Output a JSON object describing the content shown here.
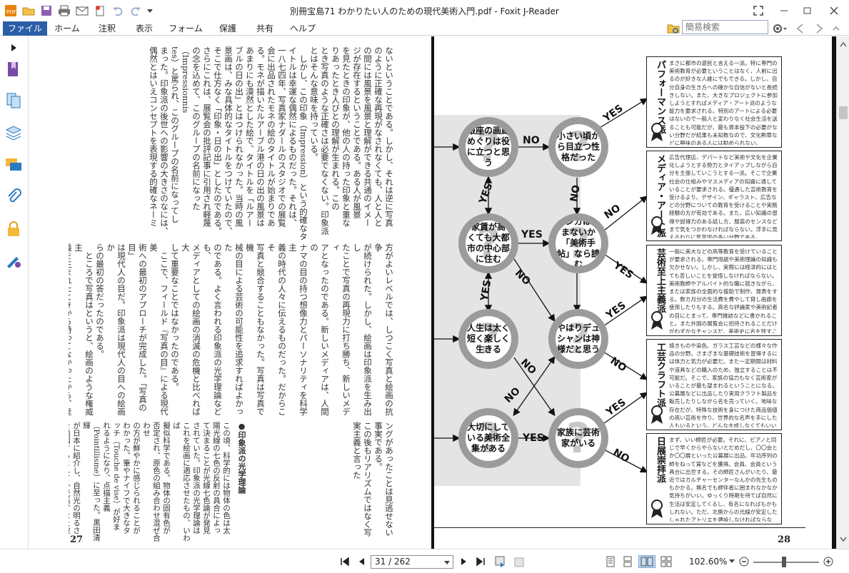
{
  "window": {
    "title": "別冊宝島71 わかりたい人のための現代美術入門.pdf - Foxit J-Reader"
  },
  "menu_tabs": [
    "ファイル",
    "ホーム",
    "注釈",
    "表示",
    "フォーム",
    "保護",
    "共有",
    "ヘルプ"
  ],
  "search": {
    "placeholder": "簡易検索"
  },
  "status": {
    "page_display": "31 / 262",
    "zoom": "102.60%"
  },
  "left_page": {
    "number": "27",
    "top_columns": [
      "ないということである。しかし、それは逆に写真",
      "のように正確な再現がなされなくても、人と人と",
      "の間には風景を風景と理解ができる共通のイメー",
      "ジが存在するということである。ある人が風景",
      "を見たときの印象が、他の人の持った印象と重な",
      "りあったとき人びとの理解が生まれる。この",
      "とき写真のような正確さは必要でなくない。印象派",
      "とはそんな意味を持っている。",
      "　しかし、この印象（Impression）という的確なタ",
      "イトルは幸運な偶然によるものだった。それは、",
      "一八七四年、写真家ナダールのスタジオでの展覧",
      "会に出品されたモネの絵のタイトルが始まりであ",
      "る。モネが描いたルアーブル港の日の出の風景は",
      "あまりにも漠然とした絵で、タイトルを「ルアー",
      "ブルの日の出」とはつけられなかった。当時の風",
      "景画は、みな具体的なタイトルをつけていたので、",
      "そこで仕方なく「印象・日の出」としたのである。",
      "さらにこれは、展覧会の批評記事に引用され軽蔑",
      "の念を込めて、このグループの名前になった（Impressionnis",
      "tes）と罵られ、このグループの名前になってし",
      "まった。印象派の後世への影響の大きさのなには、",
      "偶然とはいえコンセプトを表現する的確なネーミ",
      "ングがあったことは見逃せない事実である。",
      "この後もリアリズムではなく写実主義と言った"
    ],
    "right_columns_top": [
      "方がよいレベルでは、しつこく写真と絵画の抗争",
      "が続けられた。しかし、絵画は印象派を生み出し",
      "たことで写真の再現力に打ち勝ち、新しいメディ",
      "アとなったのである。新しいメディアは、人間の",
      "ナマの目の持つ想像力とパーソナリティを科学主",
      "義の時代の人々に伝えるものだった。だからこそ",
      "写真と競合することもなかった。写真は写真で機",
      "械の目による芸術の可能性を追求すればよかった",
      "のである。よく言われる印象派の光学理論なども、",
      "メディアとしての絵画の消滅の危機と比べれば大",
      "して重要なことではなかったのである。",
      "　ここで、フィールド『写真の目』による現代美",
      "術への最初のアプローチが完成した。「写真の目」",
      "は現代人の目だ。印象派は現代人の目への絵画か",
      "らの最初の答だったのである。",
      "　ところで写真はというと、絵画のような権威主",
      "義を生まれたときから持ってなかったから、産業",
      "の発達に押されるままに新たな方向に進出して",
      "行った。ゴッホやゴーギャンが登場する後期印象",
      "派（P32）と呼ばれる時代には、映画とアマチュア",
      "写真、グラビア印刷という新たなヴィジュアルも",
      "生み出される。これはたちまち絵画へのフィードバ",
      "ックされ、再び過激な時代に突入していくのであ",
      "る。"
    ],
    "note_title": "●印象派の光学理論",
    "note_columns": [
      "この頃、科学的には物体の色は太",
      "陽光線の七色の反射の具合によっ",
      "て決まることが光線七色論が発見",
      "されていた。印象派の光学理論は",
      "これを絵画に適応させたもの、いわば",
      "擬似科学である。物体の固有色が",
      "否定され、原色の組み合わせ混ぜ合わせ",
      "の方が鮮やかに感じられることが",
      "わかった。筆やナイフで大きなタ",
      "ッチ（Touche de vise）が好ま",
      "れるようになり、点描主義",
      "（Pointillisme）に至った。黒田清輝",
      "が日本に紹介し、自然光の明るさ",
      "を強調するとして外光派、また彼",
      "らが陰影に黒を使わなかったことか",
      "ら、むらさき派とも呼ばれた。"
    ]
  },
  "right_page": {
    "number": "28",
    "nodes": [
      "銀座の画廊めぐりは役に立つと思う",
      "小さい頃から目立つ性格だった",
      "家賃が高くても大都市の中心部に住む",
      "マンガは読まないか「美術手帖」なら読む",
      "人生は太く短く楽しく生きる",
      "やはりデュシャンは神様だと思う",
      "大切にしている美術全集がある",
      "家族に芸術家がいる"
    ],
    "labels": {
      "yes": "YES",
      "no": "NO"
    },
    "results": [
      {
        "title": "パフォーマンス派",
        "body": "まさに都市の遊民と言える一派。特に専門の美術教育が必要ということはなく、人前に出るのが好きな人誰にでもできる。しかし、自分自身の生き方への確かな自信がないと長続きしない。また、大きなプロジェクトに参加しようとすればメディア・アート派のような能力を要求される。特別のアートによる必要はないので一般人と変わりなく社会生活を送ることも可能だが、最も資本投下の必要がない分野だが結果も未知数なので、文化勲章などに興味のある人には勧められない。"
      },
      {
        "title": "メディア・アート派",
        "body": "広告代理店、デパートなど美術や文化を企業化しようとする勢力とタイアップしながら自分を主張していこうとする一派。そこで企業社会の仕組みやマスメディアの知識に通していることが要求される。優遇した芸術教育を受けるより、デザイン、ギャラスト、広告などの分野についての教育を受けることや実務経験の方が有効である。また、広い知識の習得や説得力のある話し方、服装のセンスなどまで気をつかわなければならない。浮手に見えるわりに気苦労の多い分野である。"
      },
      {
        "title": "芸術至上主義派",
        "body": "一般に美大などの高等教育を受けていることが要求される。専門用語や美術理論の知識も欠かせない。しかし、実際には経済的にはとても苦しいことを覚悟しなければならない。美術教師やアルバイト的な職に就きながら、または家族の全面的な援助で制作、発表をする。数カ月分の生活費を費やして貸し画廊を使用したりもする。高名な評論家や美術記者の目にとまって、専門雑誌などに書かれること。また外国の展覧会に招待されることだけがわずかなチャンスだ。美術史に名を残すことが最大の名誉なのである。"
      },
      {
        "title": "工芸クラフト派",
        "body": "焼きものや染色、ガラス工芸などの様々な作品の分野。さまざまな基礎技術を習得するには体力と気力が必要だ。また一定期間は材料や道具などの購入のため、独立することは不可能だ。そこで、家族の協力もなく芸術家がいることが最も望まれるということになる。公募展などに出品したり実用クラフト製品を販売したりしながら名を売っていく。地味な存在だが、特殊な技術を身につけた商品価値の高い芸術を作り、世界的な名声を手にした人もいるという。どんな大成しなくてもいいのだ。もちろん、親の七光りという手もある。"
      },
      {
        "title": "日展崇拝派",
        "body": "まず、いい師匠が必要。それに、ピアノと同じで早くからやらないとだめだし、〇〇会とか〇〇展といった公募展に出品、年功序列の師をねって賞などを獲得。会員、会員という具合に出世する。その師匠さんがいたり、最近ではカルチャーセンターなんかの先生ものもかかる。無名でも師伴者に囲まれなかなか気持ちがいい。ゆっくり時期を待てば自然に生活は安定してくるし、有名になればもかもしれない。ただ、北側からの光線が安定したしゃれたアトリエを建設しなければならない。"
      }
    ]
  },
  "colors": {
    "accent": "#2b5ea8",
    "node_ring": "#9b9b9b",
    "shade": "#e4e4e4"
  },
  "icons": [
    "app-logo-icon",
    "open-folder-icon",
    "save-icon",
    "print-icon",
    "email-icon",
    "new-icon",
    "undo-icon",
    "redo-icon",
    "fullscreen-icon",
    "minimize-icon",
    "maximize-icon",
    "close-icon",
    "find-folder-icon",
    "search-icon",
    "settings-icon",
    "bookmark-icon",
    "pages-icon",
    "layers-icon",
    "comments-icon",
    "attachment-icon",
    "security-icon",
    "signature-icon",
    "first-page-icon",
    "prev-page-icon",
    "next-page-icon",
    "last-page-icon",
    "zoom-out-icon",
    "zoom-in-icon"
  ]
}
